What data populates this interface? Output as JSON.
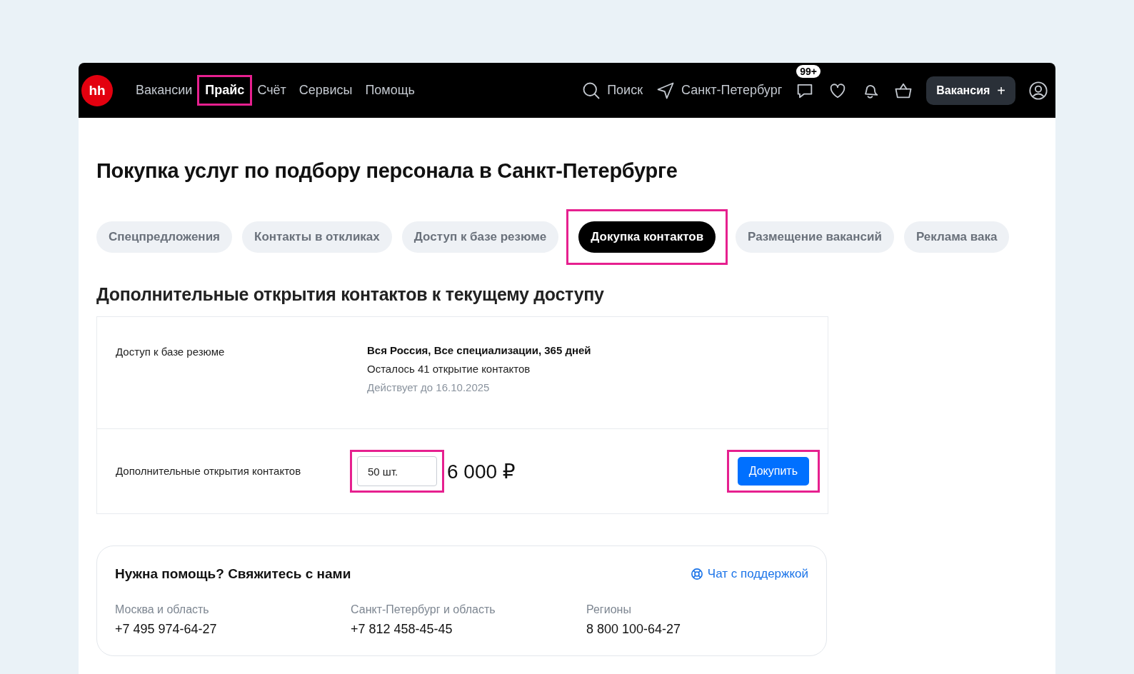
{
  "nav": {
    "logo": "hh",
    "links": [
      {
        "label": "Вакансии",
        "selected": false,
        "highlighted": false
      },
      {
        "label": "Прайс",
        "selected": true,
        "highlighted": true
      },
      {
        "label": "Счёт",
        "selected": false,
        "highlighted": false
      },
      {
        "label": "Сервисы",
        "selected": false,
        "highlighted": false
      },
      {
        "label": "Помощь",
        "selected": false,
        "highlighted": false
      }
    ],
    "search": "Поиск",
    "city": "Санкт-Петербург",
    "badge": "99+",
    "vacancy_button": {
      "label": "Вакансия",
      "icon": "+"
    }
  },
  "title": "Покупка услуг по подбору персонала в Санкт-Петербурге",
  "tabs": [
    {
      "label": "Спецпредложения",
      "selected": false,
      "highlighted": false
    },
    {
      "label": "Контакты в откликах",
      "selected": false,
      "highlighted": false
    },
    {
      "label": "Доступ к базе резюме",
      "selected": false,
      "highlighted": false
    },
    {
      "label": "Докупка контактов",
      "selected": true,
      "highlighted": true
    },
    {
      "label": "Размещение вакансий",
      "selected": false,
      "highlighted": false
    },
    {
      "label": "Реклама вака",
      "selected": false,
      "highlighted": false
    }
  ],
  "section_title": "Дополнительные открытия контактов к текущему доступу",
  "access_row": {
    "label": "Доступ к базе резюме",
    "lines": [
      {
        "kind": "bold",
        "text": "Вся Россия, Все специализации, 365 дней"
      },
      {
        "kind": "normal",
        "text": "Осталось 41 открытие контактов"
      },
      {
        "kind": "muted",
        "text": "Действует до 16.10.2025"
      }
    ]
  },
  "purchase_row": {
    "label": "Дополнительные открытия контактов",
    "quantity": {
      "value": "50 шт.",
      "highlighted": true
    },
    "price": "6 000 ₽",
    "button": {
      "label": "Докупить",
      "highlighted": true
    }
  },
  "help": {
    "title": "Нужна помощь? Свяжитесь с нами",
    "chat_link": "Чат с поддержкой",
    "contacts": [
      {
        "region": "Москва и область",
        "phone": "+7 495 974-64-27"
      },
      {
        "region": "Санкт-Петербург и область",
        "phone": "+7 812 458-45-45"
      },
      {
        "region": "Регионы",
        "phone": "8 800 100-64-27"
      }
    ]
  }
}
